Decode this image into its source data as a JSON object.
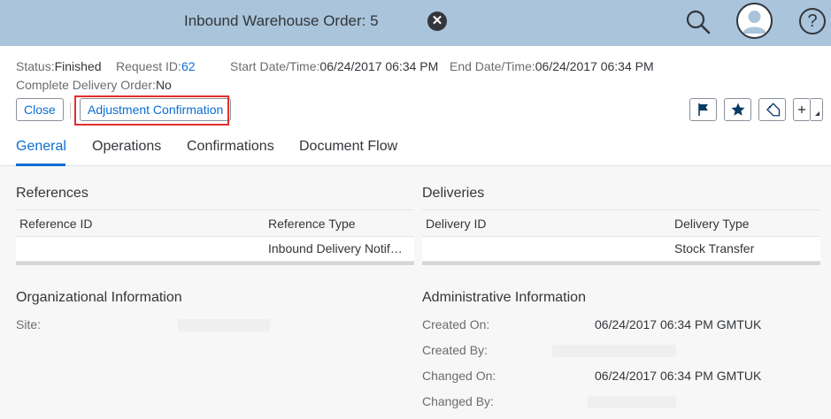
{
  "shell": {
    "title": "Inbound Warehouse Order: 5",
    "close_icon": "close-circle-icon",
    "search_icon": "search-icon",
    "avatar_icon": "user-avatar-icon",
    "help_icon": "help-icon",
    "help_glyph": "?",
    "close_glyph": "✕"
  },
  "header": {
    "status_label": "Status:",
    "status_value": "Finished",
    "request_label": "Request ID:",
    "request_value": "62",
    "start_label": "Start Date/Time:",
    "start_value": "06/24/2017 06:34 PM",
    "end_label": "End Date/Time:",
    "end_value": "06/24/2017 06:34 PM",
    "complete_label": "Complete Delivery Order:",
    "complete_value": "No"
  },
  "actions": {
    "close_label": "Close",
    "adjustment_label": "Adjustment Confirmation",
    "icons": [
      "flag-icon",
      "favorite-star-icon",
      "tag-icon",
      "add-tile-icon"
    ]
  },
  "tabs": [
    {
      "label": "General",
      "active": true
    },
    {
      "label": "Operations",
      "active": false
    },
    {
      "label": "Confirmations",
      "active": false
    },
    {
      "label": "Document Flow",
      "active": false
    }
  ],
  "references": {
    "title": "References",
    "columns": [
      "Reference ID",
      "Reference Type"
    ],
    "rows": [
      [
        "",
        "Inbound Delivery Notif…"
      ]
    ]
  },
  "deliveries": {
    "title": "Deliveries",
    "columns": [
      "Delivery ID",
      "Delivery Type"
    ],
    "rows": [
      [
        "",
        "Stock Transfer"
      ]
    ]
  },
  "org_info": {
    "title": "Organizational Information",
    "site_label": "Site:",
    "site_value": ""
  },
  "admin_info": {
    "title": "Administrative Information",
    "created_on_label": "Created On:",
    "created_on_value": "06/24/2017 06:34 PM GMTUK",
    "created_by_label": "Created By:",
    "created_by_value": "",
    "changed_on_label": "Changed On:",
    "changed_on_value": "06/24/2017 06:34 PM GMTUK",
    "changed_by_label": "Changed By:",
    "changed_by_value": ""
  },
  "colors": {
    "shell_bg": "#a9c4db",
    "accent": "#0a6ed1",
    "highlight": "#e52d2d"
  }
}
